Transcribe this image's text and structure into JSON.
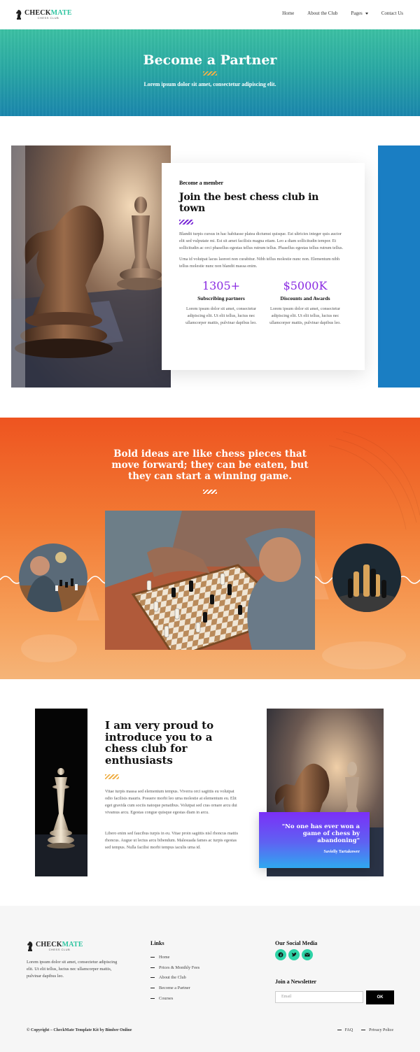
{
  "brand": {
    "name_part1": "CHECK",
    "name_part2": "MATE",
    "tagline": "CHESS CLUB"
  },
  "nav": {
    "items": [
      "Home",
      "About the Club",
      "Pages",
      "Contact Us"
    ]
  },
  "hero": {
    "title": "Become a Partner",
    "subtitle": "Lorem ipsum dolor sit amet, consectetur adipiscing elit."
  },
  "about": {
    "kicker": "Become a member",
    "title": "Join the best chess club in town",
    "paragraph1": "Blandit turpis cursus in hac habitasse platea dictumst quisque. Est ultricies integer quis auctor elit sed vulputate mi. Est sit amet facilisis magna etiam. Leo a diam sollicitudin tempor. Et sollicitudin ac orci phasellus egestas tellus rutrum tellus. Phasellus egestas tellus rutrum tellus.",
    "paragraph2": "Urna id volutpat lacus laoreet non curabitur. Nibh tellus molestie nunc non. Elementum nibh tellus molestie nunc non blandit massa enim.",
    "stats": [
      {
        "number": "1305+",
        "label": "Subscribing partners",
        "desc": "Lorem ipsum dolor sit amet, consectetur adipiscing elit. Ut elit tellus, luctus nec ullamcorper mattis, pulvinar dapibus leo."
      },
      {
        "number": "$5000K",
        "label": "Discounts and Awards",
        "desc": "Lorem ipsum dolor sit amet, consectetur adipiscing elit. Ut elit tellus, luctus nec ullamcorper mattis, pulvinar dapibus leo."
      }
    ]
  },
  "quote_section": {
    "text": "Bold ideas are like chess pieces that move forward; they can be eaten, but they can start a winning game."
  },
  "intro": {
    "title": "I am very proud to introduce you to a chess club for enthusiasts",
    "paragraph1": "Vitae turpis massa sed elementum tempus. Viverra orci sagittis eu volutpat odio facilisis mauris. Posuere morbi leo urna molestie at elementum eu. Elit eget gravida cum sociis natoque penatibus. Volutpat sed cras ornare arcu dui vivamus arcu. Egestas congue quisque egestas diam in arcu.",
    "paragraph2": "Libero enim sed faucibus turpis in eu. Vitae proin sagittis nisl rhoncus mattis rhoncus. Augue ut lectus arcu bibendum. Malesuada fames ac turpis egestas sed tempus. Nulla facilisi morbi tempus iaculis urna id.",
    "quote": "\"No one has ever won a game of chess by abandoning\"",
    "quote_author": "Savielly Tartakower"
  },
  "footer": {
    "about": "Lorem ipsum dolor sit amet, consectetur adipiscing elit. Ut elit tellus, luctus nec ullamcorper mattis, pulvinar dapibus leo.",
    "links_title": "Links",
    "links": [
      "Home",
      "Prices & Monthly Fees",
      "About the Club",
      "Become a Partner",
      "Courses"
    ],
    "social_title": "Our Social Media",
    "social_icons": [
      "facebook-icon",
      "twitter-icon",
      "email-icon"
    ],
    "newsletter_title": "Join a Newsletter",
    "newsletter_placeholder": "Email",
    "newsletter_button": "OK",
    "copyright": "© Copyright – CheckMate Template Kit by Bimber Online",
    "bottom_links": [
      "FAQ",
      "Privacy Police"
    ]
  },
  "colors": {
    "teal": "#2fd3a7",
    "blue": "#1a7ec3",
    "purple": "#8a2be2",
    "orange": "#f27a34",
    "gold": "#f0b049"
  }
}
